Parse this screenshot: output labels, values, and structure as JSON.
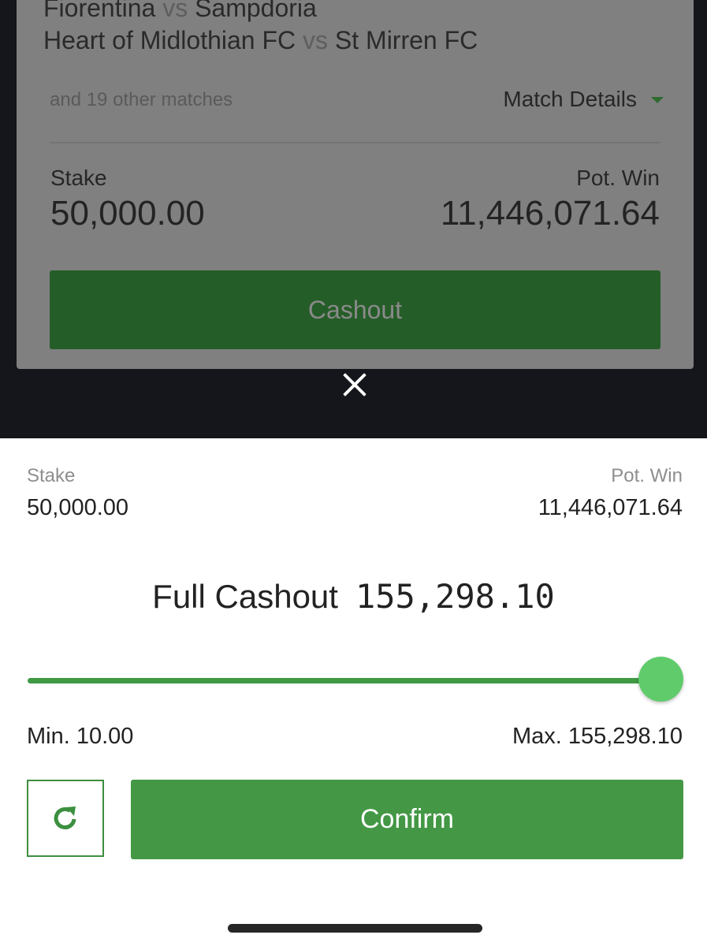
{
  "bet_card": {
    "matches": [
      {
        "home": "Fiorentina",
        "vs": "vs",
        "away": "Sampdoria"
      },
      {
        "home": "Heart of Midlothian FC",
        "vs": "vs",
        "away": "St Mirren FC"
      }
    ],
    "other_matches": "and 19 other matches",
    "match_details_label": "Match Details",
    "stake_label": "Stake",
    "stake_value": "50,000.00",
    "pot_win_label": "Pot. Win",
    "pot_win_value": "11,446,071.64",
    "cashout_label": "Cashout"
  },
  "sheet": {
    "stake_label": "Stake",
    "stake_value": "50,000.00",
    "pot_win_label": "Pot. Win",
    "pot_win_value": "11,446,071.64",
    "full_cashout_label": "Full Cashout",
    "full_cashout_amount": "155,298.10",
    "slider_fraction": 1.0,
    "min_label": "Min. 10.00",
    "max_label": "Max. 155,298.10",
    "confirm_label": "Confirm"
  },
  "icons": {
    "close": "close-icon",
    "refresh": "refresh-icon",
    "caret": "chevron-down-icon"
  },
  "colors": {
    "accent_green": "#449845",
    "slider_thumb": "#5fcb6a",
    "overlay": "#15161b"
  }
}
